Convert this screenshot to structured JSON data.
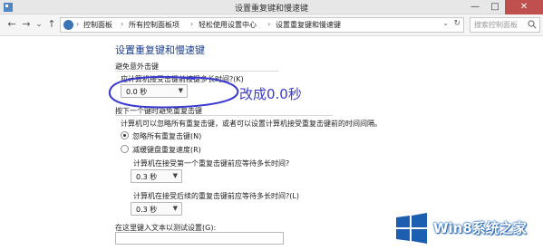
{
  "window": {
    "title": "设置重复键和慢速键",
    "minimize_glyph": "—",
    "maximize_glyph": "□",
    "close_glyph": "✕"
  },
  "nav": {
    "back_glyph": "←",
    "forward_glyph": "→",
    "history_glyph": "⌄",
    "up_glyph": "↑",
    "breadcrumbs": [
      "控制面板",
      "所有控制面板项",
      "轻松使用设置中心",
      "设置重复键和慢速键"
    ],
    "separator": "›",
    "dropdown_glyph": "⌄",
    "refresh_glyph": "↻",
    "search_placeholder": "搜索控制面板"
  },
  "page": {
    "heading": "设置重复键和慢速键",
    "section1": {
      "label": "避免意外击键",
      "question": "应计算机接受击键前按键多长时间?(K)",
      "dropdown_value": "0.0 秒"
    },
    "section2": {
      "label": "按下一个键时避免重复击键",
      "description": "计算机可以忽略所有重复击键，或者可以设置计算机接受重复击键前的时间间隔。",
      "radio1_label": "忽略所有重复击键(N)",
      "radio2_label": "减缓键盘重复速度(R)",
      "sub1_question": "计算机在接受第一个重复击键前应等待多长时间?",
      "sub1_value": "0.3 秒",
      "sub2_question": "计算机在接受后续的重复击键前应等待多长时间?(L)",
      "sub2_value": "0.3 秒",
      "test_label": "在这里键入文本以测试设置(G):"
    }
  },
  "annotation": {
    "text": "改成0.0秒",
    "color": "#3a3ad0"
  },
  "watermark": {
    "text": "Win8系统之家",
    "brand_color": "#1c5fb0"
  }
}
